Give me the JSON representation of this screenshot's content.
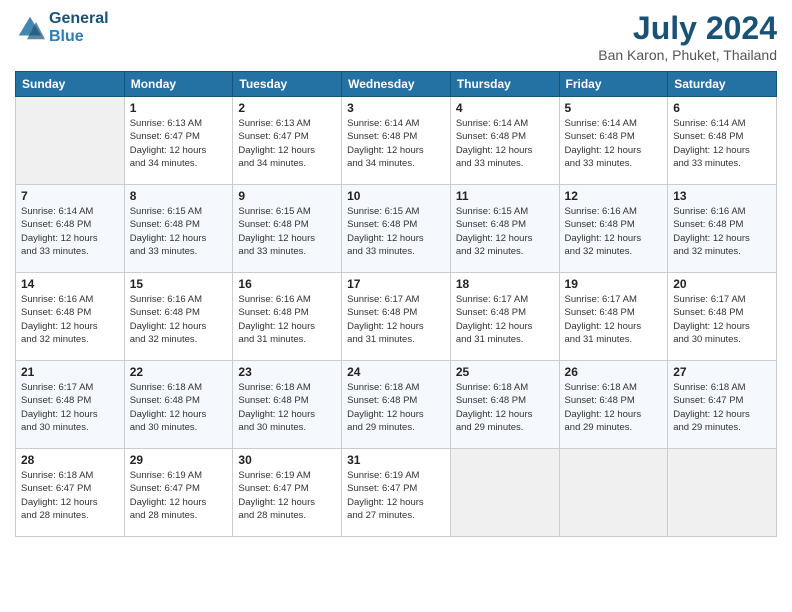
{
  "header": {
    "logo_line1": "General",
    "logo_line2": "Blue",
    "month_year": "July 2024",
    "location": "Ban Karon, Phuket, Thailand"
  },
  "days_of_week": [
    "Sunday",
    "Monday",
    "Tuesday",
    "Wednesday",
    "Thursday",
    "Friday",
    "Saturday"
  ],
  "weeks": [
    [
      {
        "day": "",
        "info": ""
      },
      {
        "day": "1",
        "info": "Sunrise: 6:13 AM\nSunset: 6:47 PM\nDaylight: 12 hours\nand 34 minutes."
      },
      {
        "day": "2",
        "info": "Sunrise: 6:13 AM\nSunset: 6:47 PM\nDaylight: 12 hours\nand 34 minutes."
      },
      {
        "day": "3",
        "info": "Sunrise: 6:14 AM\nSunset: 6:48 PM\nDaylight: 12 hours\nand 34 minutes."
      },
      {
        "day": "4",
        "info": "Sunrise: 6:14 AM\nSunset: 6:48 PM\nDaylight: 12 hours\nand 33 minutes."
      },
      {
        "day": "5",
        "info": "Sunrise: 6:14 AM\nSunset: 6:48 PM\nDaylight: 12 hours\nand 33 minutes."
      },
      {
        "day": "6",
        "info": "Sunrise: 6:14 AM\nSunset: 6:48 PM\nDaylight: 12 hours\nand 33 minutes."
      }
    ],
    [
      {
        "day": "7",
        "info": ""
      },
      {
        "day": "8",
        "info": "Sunrise: 6:15 AM\nSunset: 6:48 PM\nDaylight: 12 hours\nand 33 minutes."
      },
      {
        "day": "9",
        "info": "Sunrise: 6:15 AM\nSunset: 6:48 PM\nDaylight: 12 hours\nand 33 minutes."
      },
      {
        "day": "10",
        "info": "Sunrise: 6:15 AM\nSunset: 6:48 PM\nDaylight: 12 hours\nand 33 minutes."
      },
      {
        "day": "11",
        "info": "Sunrise: 6:15 AM\nSunset: 6:48 PM\nDaylight: 12 hours\nand 32 minutes."
      },
      {
        "day": "12",
        "info": "Sunrise: 6:16 AM\nSunset: 6:48 PM\nDaylight: 12 hours\nand 32 minutes."
      },
      {
        "day": "13",
        "info": "Sunrise: 6:16 AM\nSunset: 6:48 PM\nDaylight: 12 hours\nand 32 minutes."
      }
    ],
    [
      {
        "day": "14",
        "info": ""
      },
      {
        "day": "15",
        "info": "Sunrise: 6:16 AM\nSunset: 6:48 PM\nDaylight: 12 hours\nand 32 minutes."
      },
      {
        "day": "16",
        "info": "Sunrise: 6:16 AM\nSunset: 6:48 PM\nDaylight: 12 hours\nand 31 minutes."
      },
      {
        "day": "17",
        "info": "Sunrise: 6:17 AM\nSunset: 6:48 PM\nDaylight: 12 hours\nand 31 minutes."
      },
      {
        "day": "18",
        "info": "Sunrise: 6:17 AM\nSunset: 6:48 PM\nDaylight: 12 hours\nand 31 minutes."
      },
      {
        "day": "19",
        "info": "Sunrise: 6:17 AM\nSunset: 6:48 PM\nDaylight: 12 hours\nand 31 minutes."
      },
      {
        "day": "20",
        "info": "Sunrise: 6:17 AM\nSunset: 6:48 PM\nDaylight: 12 hours\nand 30 minutes."
      }
    ],
    [
      {
        "day": "21",
        "info": ""
      },
      {
        "day": "22",
        "info": "Sunrise: 6:18 AM\nSunset: 6:48 PM\nDaylight: 12 hours\nand 30 minutes."
      },
      {
        "day": "23",
        "info": "Sunrise: 6:18 AM\nSunset: 6:48 PM\nDaylight: 12 hours\nand 30 minutes."
      },
      {
        "day": "24",
        "info": "Sunrise: 6:18 AM\nSunset: 6:48 PM\nDaylight: 12 hours\nand 29 minutes."
      },
      {
        "day": "25",
        "info": "Sunrise: 6:18 AM\nSunset: 6:48 PM\nDaylight: 12 hours\nand 29 minutes."
      },
      {
        "day": "26",
        "info": "Sunrise: 6:18 AM\nSunset: 6:48 PM\nDaylight: 12 hours\nand 29 minutes."
      },
      {
        "day": "27",
        "info": "Sunrise: 6:18 AM\nSunset: 6:47 PM\nDaylight: 12 hours\nand 29 minutes."
      }
    ],
    [
      {
        "day": "28",
        "info": "Sunrise: 6:18 AM\nSunset: 6:47 PM\nDaylight: 12 hours\nand 28 minutes."
      },
      {
        "day": "29",
        "info": "Sunrise: 6:19 AM\nSunset: 6:47 PM\nDaylight: 12 hours\nand 28 minutes."
      },
      {
        "day": "30",
        "info": "Sunrise: 6:19 AM\nSunset: 6:47 PM\nDaylight: 12 hours\nand 28 minutes."
      },
      {
        "day": "31",
        "info": "Sunrise: 6:19 AM\nSunset: 6:47 PM\nDaylight: 12 hours\nand 27 minutes."
      },
      {
        "day": "",
        "info": ""
      },
      {
        "day": "",
        "info": ""
      },
      {
        "day": "",
        "info": ""
      }
    ]
  ],
  "week7_day7_info": "Sunrise: 6:14 AM\nSunset: 6:48 PM\nDaylight: 12 hours\nand 33 minutes.",
  "week14_day14_info": "Sunrise: 6:16 AM\nSunset: 6:48 PM\nDaylight: 12 hours\nand 32 minutes.",
  "week21_day21_info": "Sunrise: 6:17 AM\nSunset: 6:48 PM\nDaylight: 12 hours\nand 30 minutes."
}
